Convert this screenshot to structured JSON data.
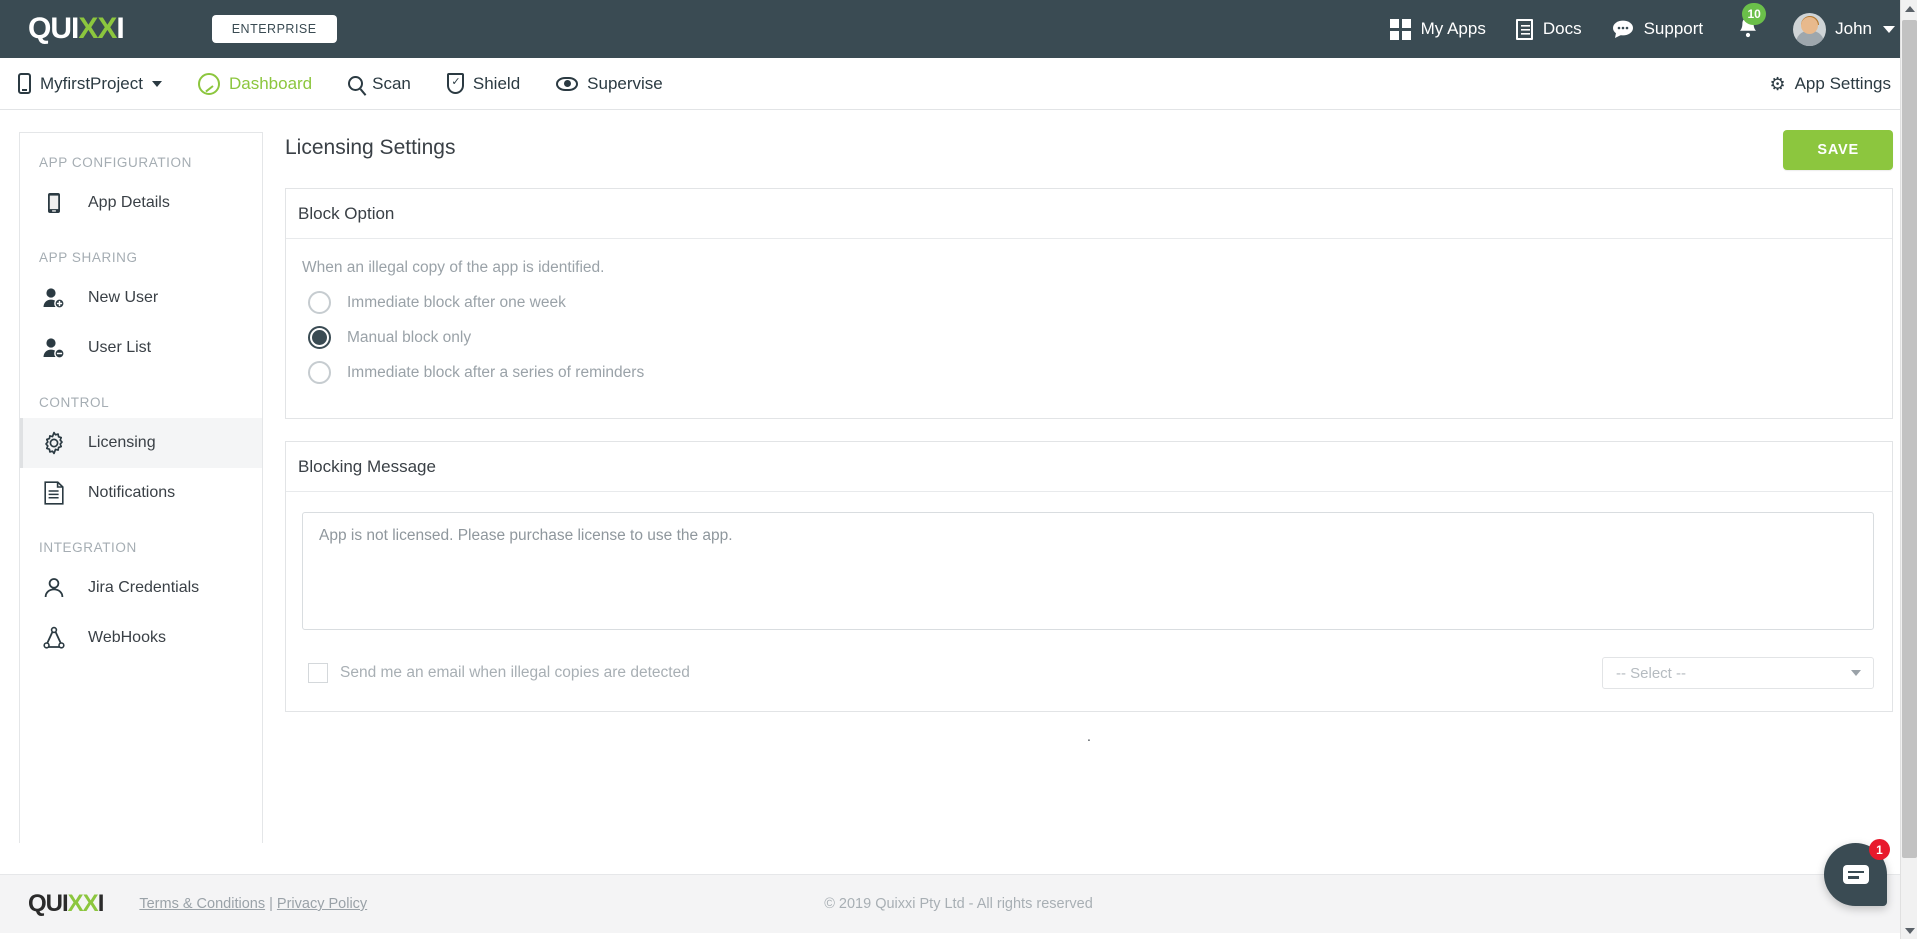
{
  "topbar": {
    "logo_prefix": "QUI",
    "logo_accent": "XX",
    "logo_suffix": "I",
    "enterprise_label": "ENTERPRISE",
    "nav": [
      {
        "label": "My Apps",
        "icon": "grid-icon"
      },
      {
        "label": "Docs",
        "icon": "docs-icon"
      },
      {
        "label": "Support",
        "icon": "chat-bubble-icon"
      }
    ],
    "notification_count": "10",
    "notification_badge_color": "#6bbf4a",
    "user_name": "John"
  },
  "subnav": {
    "project_name": "MyfirstProject",
    "items": [
      {
        "label": "Dashboard",
        "icon": "gauge-icon",
        "active": true
      },
      {
        "label": "Scan",
        "icon": "search-icon",
        "active": false
      },
      {
        "label": "Shield",
        "icon": "shield-icon",
        "active": false
      },
      {
        "label": "Supervise",
        "icon": "eye-icon",
        "active": false
      }
    ],
    "active_color": "#8cc63e",
    "app_settings_label": "App Settings"
  },
  "sidebar": {
    "sections": [
      {
        "title": "APP CONFIGURATION",
        "items": [
          {
            "label": "App Details",
            "icon": "mobile-phone-icon",
            "active": false
          }
        ]
      },
      {
        "title": "APP SHARING",
        "items": [
          {
            "label": "New User",
            "icon": "user-add-icon",
            "active": false
          },
          {
            "label": "User List",
            "icon": "user-remove-icon",
            "active": false
          }
        ]
      },
      {
        "title": "CONTROL",
        "items": [
          {
            "label": "Licensing",
            "icon": "gear-icon",
            "active": true
          },
          {
            "label": "Notifications",
            "icon": "document-list-icon",
            "active": false
          }
        ]
      },
      {
        "title": "INTEGRATION",
        "items": [
          {
            "label": "Jira Credentials",
            "icon": "person-icon",
            "active": false
          },
          {
            "label": "WebHooks",
            "icon": "webhook-icon",
            "active": false
          }
        ]
      }
    ]
  },
  "main": {
    "page_title": "Licensing Settings",
    "save_label": "SAVE",
    "save_color": "#8cc63e",
    "block_option": {
      "panel_title": "Block Option",
      "hint": "When an illegal copy of the app is identified.",
      "options": [
        {
          "label": "Immediate block after one week",
          "selected": false
        },
        {
          "label": "Manual block only",
          "selected": true
        },
        {
          "label": "Immediate block after a series of reminders",
          "selected": false
        }
      ]
    },
    "blocking_message": {
      "panel_title": "Blocking Message",
      "textarea_value": "App is not licensed. Please purchase license to use the app.",
      "email_checkbox_label": "Send me an email when illegal copies are detected",
      "email_checkbox_checked": false,
      "select_value": "-- Select --"
    },
    "stray_dot": "."
  },
  "footer": {
    "logo_prefix": "QUI",
    "logo_accent": "XX",
    "logo_suffix": "I",
    "terms_label": "Terms & Conditions",
    "separator": "|",
    "privacy_label": "Privacy Policy",
    "copyright": "© 2019 Quixxi Pty Ltd - All rights reserved"
  },
  "chat": {
    "badge_count": "1",
    "badge_color": "#e8192c"
  }
}
